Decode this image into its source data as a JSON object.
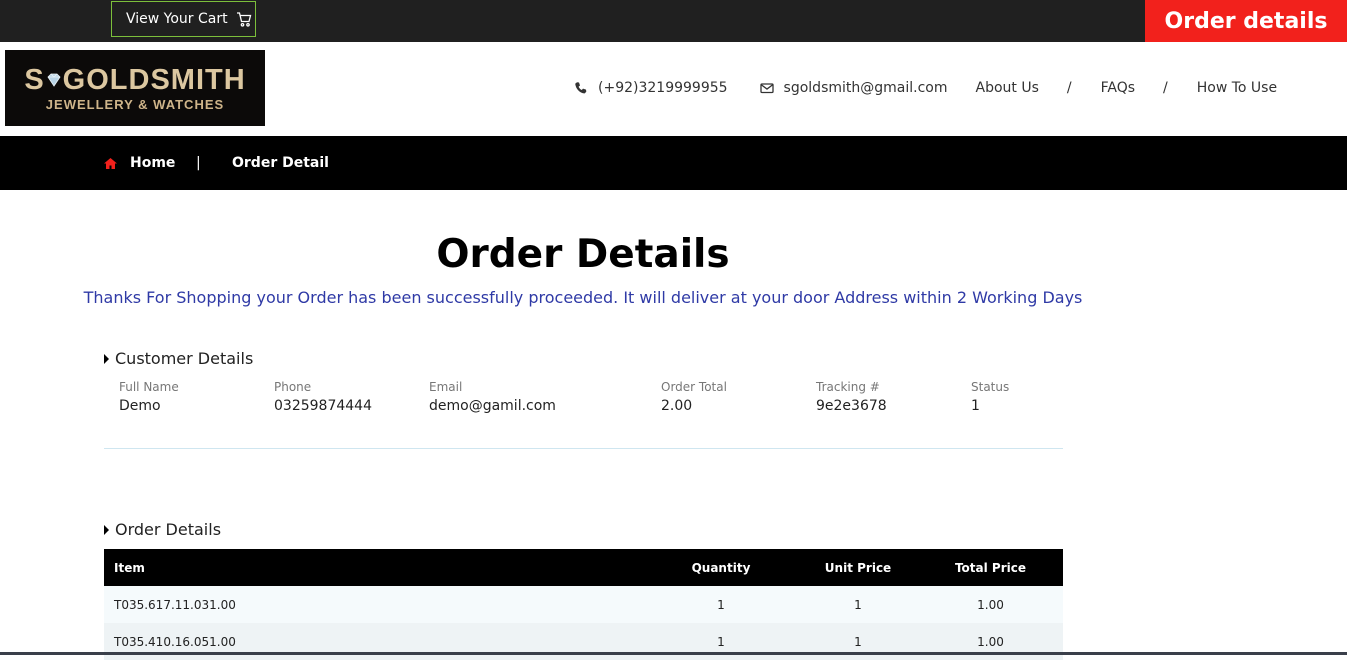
{
  "topbar": {
    "cart_label": "View Your Cart",
    "order_tab_label": "Order details"
  },
  "logo": {
    "brand_left": "S",
    "brand_right": "GOLDSMITH",
    "tagline": "JEWELLERY & WATCHES"
  },
  "nav": {
    "phone": "(+92)3219999955",
    "email": "sgoldsmith@gmail.com",
    "links": [
      "About Us",
      "FAQs",
      "How To Use"
    ],
    "separator": "/"
  },
  "breadcrumb": {
    "home": "Home",
    "separator": "|",
    "current": "Order Detail"
  },
  "main": {
    "title": "Order Details",
    "thanks": "Thanks For Shopping your Order has been successfully proceeded. It will deliver at your door Address within 2 Working Days"
  },
  "customer": {
    "heading": "Customer Details",
    "fields": [
      {
        "label": "Full Name",
        "value": "Demo"
      },
      {
        "label": "Phone",
        "value": "03259874444"
      },
      {
        "label": "Email",
        "value": "demo@gamil.com"
      },
      {
        "label": "Order Total",
        "value": "2.00"
      },
      {
        "label": "Tracking #",
        "value": "9e2e3678"
      },
      {
        "label": "Status",
        "value": "1"
      }
    ]
  },
  "order": {
    "heading": "Order Details",
    "columns": [
      "Item",
      "Quantity",
      "Unit Price",
      "Total Price"
    ],
    "rows": [
      [
        "T035.617.11.031.00",
        "1",
        "1",
        "1.00"
      ],
      [
        "T035.410.16.051.00",
        "1",
        "1",
        "1.00"
      ]
    ]
  },
  "colors": {
    "accent_red": "#f2211c",
    "cart_border": "#7cbf3b",
    "thanks_text": "#2f3aa6"
  }
}
